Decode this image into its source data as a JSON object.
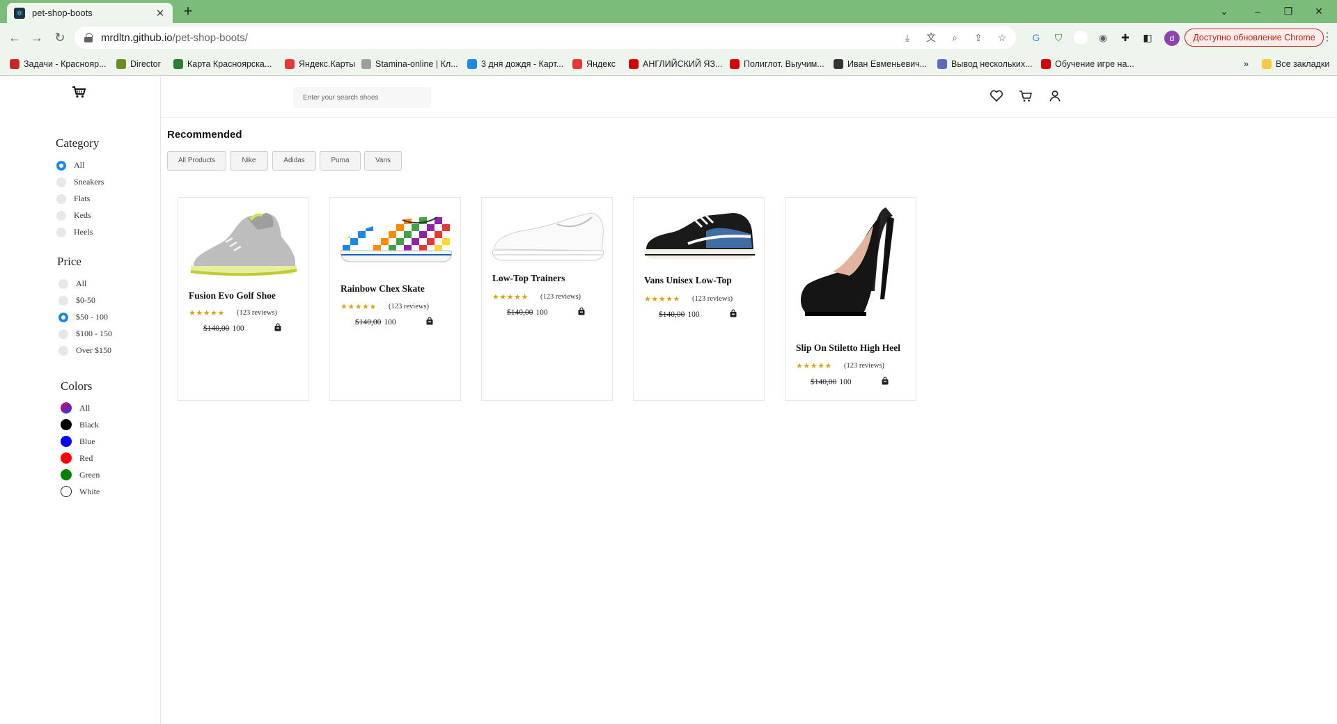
{
  "browser": {
    "tab_title": "pet-shop-boots",
    "url_host": "mrdltn.github.io",
    "url_path": "/pet-shop-boots/",
    "update_label": "Доступно обновление Chrome",
    "profile_initial": "d",
    "new_tab_label": "+",
    "close_tab_label": "✕"
  },
  "bookmarks": {
    "items": [
      {
        "label": "Задачи - Краснояр...",
        "icon_color": "#c62828"
      },
      {
        "label": "Director",
        "icon_color": "#6b8e23"
      },
      {
        "label": "Карта Красноярска...",
        "icon_color": "#2e7d32"
      },
      {
        "label": "Яндекс.Карты",
        "icon_color": "#e53935"
      },
      {
        "label": "Stamina-online | Кл...",
        "icon_color": "#9e9e9e"
      },
      {
        "label": "3 дня дождя - Карт...",
        "icon_color": "#1e88e5"
      },
      {
        "label": "Яндекс",
        "icon_color": "#e53935"
      },
      {
        "label": "АНГЛИЙСКИЙ ЯЗ...",
        "icon_color": "#d50000"
      },
      {
        "label": "Полиглот. Выучим...",
        "icon_color": "#d50000"
      },
      {
        "label": "Иван Евменьевич...",
        "icon_color": "#333333"
      },
      {
        "label": "Вывод нескольких...",
        "icon_color": "#5c6bc0"
      },
      {
        "label": "Обучение игре на...",
        "icon_color": "#d50000"
      }
    ],
    "overflow_label": "»",
    "all_bookmarks": "Все закладки"
  },
  "header": {
    "search_placeholder": "Enter your search shoes"
  },
  "sidebar": {
    "category": {
      "title": "Category",
      "options": [
        "All",
        "Sneakers",
        "Flats",
        "Keds",
        "Heels"
      ],
      "selected": "All"
    },
    "price": {
      "title": "Price",
      "options": [
        "All",
        "$0-50",
        "$50 - 100",
        "$100 - 150",
        "Over $150"
      ],
      "selected": "$50 - 100"
    },
    "colors": {
      "title": "Colors",
      "options": [
        {
          "label": "All",
          "color": "gradient"
        },
        {
          "label": "Black",
          "color": "#000000"
        },
        {
          "label": "Blue",
          "color": "#0000ff"
        },
        {
          "label": "Red",
          "color": "#ff0000"
        },
        {
          "label": "Green",
          "color": "#008000"
        },
        {
          "label": "White",
          "color": "#ffffff"
        }
      ]
    }
  },
  "recommended": {
    "title": "Recommended",
    "buttons": [
      "All Products",
      "Nike",
      "Adidas",
      "Puma",
      "Vans"
    ]
  },
  "products": [
    {
      "title": "Fusion Evo Golf Shoe",
      "stars": "★★★★★",
      "reviews": "(123 reviews)",
      "old_price": "$140,00",
      "price": "100",
      "image": "golf-shoe"
    },
    {
      "title": "Rainbow Chex Skate",
      "stars": "★★★★★",
      "reviews": "(123 reviews)",
      "old_price": "$140,00",
      "price": "100",
      "image": "checker-slipon"
    },
    {
      "title": "Low-Top Trainers",
      "stars": "★★★★★",
      "reviews": "(123 reviews)",
      "old_price": "$140,00",
      "price": "100",
      "image": "white-slipon"
    },
    {
      "title": "Vans Unisex Low-Top",
      "stars": "★★★★★",
      "reviews": "(123 reviews)",
      "old_price": "$140,00",
      "price": "100",
      "image": "vans-oldskool"
    },
    {
      "title": "Slip On Stiletto High Heel",
      "stars": "★★★★★",
      "reviews": "(123 reviews)",
      "old_price": "$140,00",
      "price": "100",
      "image": "black-heel"
    }
  ]
}
